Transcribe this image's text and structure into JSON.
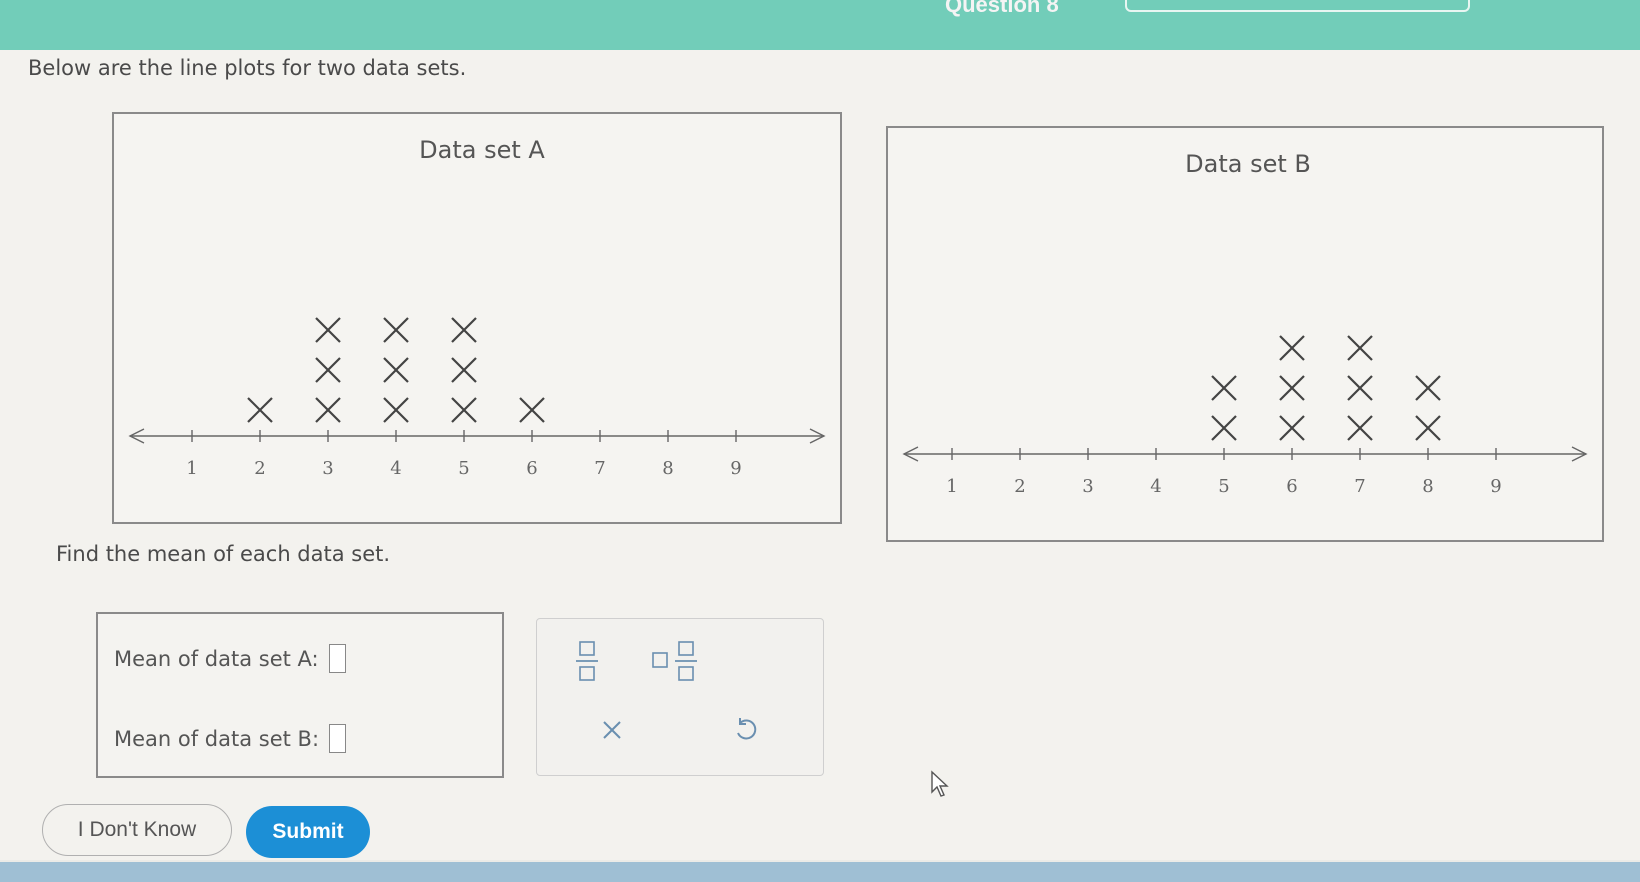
{
  "header": {
    "title": "Question 8"
  },
  "intro_text": "Below are the line plots for two data sets.",
  "instruction": "Find the mean of each data set.",
  "answers": {
    "a_label": "Mean of data set A:",
    "b_label": "Mean of data set B:",
    "a_value": "",
    "b_value": ""
  },
  "tools": {
    "fraction": "fraction-icon",
    "mixed_number": "mixed-number-icon",
    "clear": "clear-icon",
    "undo": "undo-icon"
  },
  "buttons": {
    "dont_know": "I Don't Know",
    "submit": "Submit"
  },
  "colors": {
    "header": "#72cdb9",
    "submit": "#1c8fd6"
  },
  "chart_data": [
    {
      "type": "scatter",
      "title": "Data set A",
      "axis_ticks": [
        1,
        2,
        3,
        4,
        5,
        6,
        7,
        8,
        9
      ],
      "counts": {
        "2": 1,
        "3": 3,
        "4": 3,
        "5": 3,
        "6": 1
      },
      "xlim": [
        1,
        9
      ]
    },
    {
      "type": "scatter",
      "title": "Data set B",
      "axis_ticks": [
        1,
        2,
        3,
        4,
        5,
        6,
        7,
        8,
        9
      ],
      "counts": {
        "5": 2,
        "6": 3,
        "7": 3,
        "8": 2
      },
      "xlim": [
        1,
        9
      ]
    }
  ]
}
